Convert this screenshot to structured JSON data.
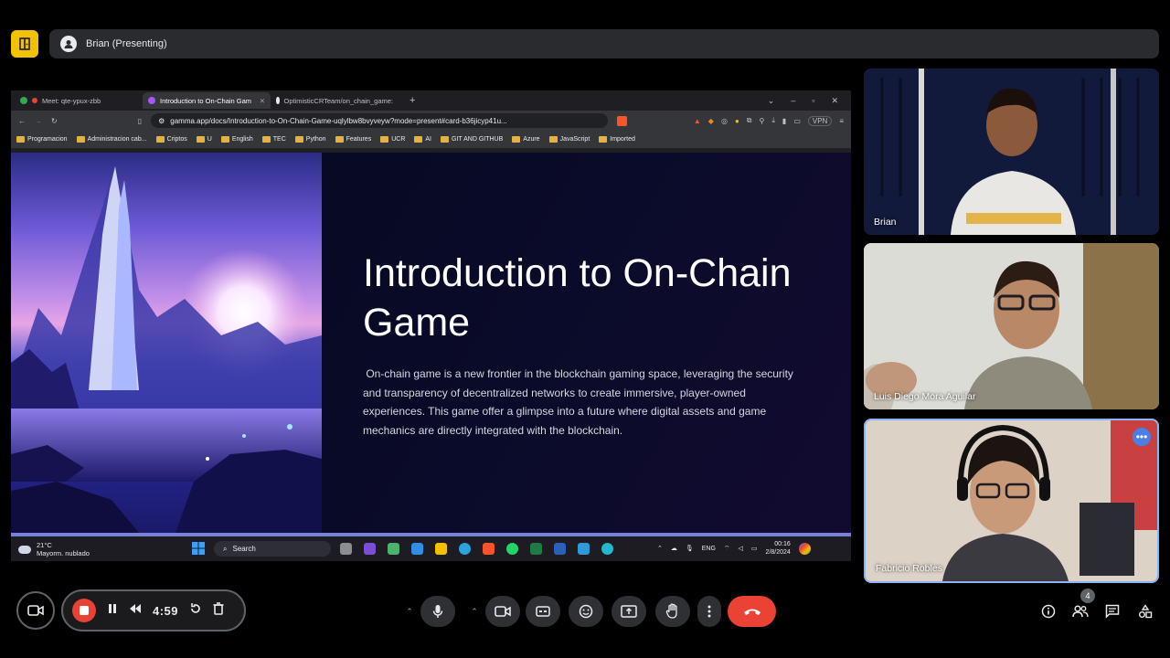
{
  "topbar": {
    "presenter_label": "Brian (Presenting)"
  },
  "browser": {
    "tabs": [
      {
        "label": "Meet: qte-ypux-zbb"
      },
      {
        "label": "Introduction to On-Chain Gam"
      },
      {
        "label": "OptimisticCRTeam/on_chain_game:"
      }
    ],
    "url": "gamma.app/docs/Introduction-to-On-Chain-Game-uqlylbw8bvyveyw?mode=present#card-b36jicyp41u...",
    "vpn_label": "VPN",
    "bookmarks": [
      "Programacion",
      "Administracion cab...",
      "Criptos",
      "U",
      "English",
      "TEC",
      "Python",
      "Features",
      "UCR",
      "AI",
      "GIT AND GITHUB",
      "Azure",
      "JavaScript",
      "Imported"
    ]
  },
  "slide": {
    "title": "Introduction to On-Chain Game",
    "body": " On-chain game is a new frontier in the blockchain gaming space, leveraging the security and transparency of decentralized networks to create immersive, player-owned experiences. This game offer a glimpse into a future where digital assets and game mechanics are directly integrated with the blockchain."
  },
  "taskbar": {
    "temperature": "21°C",
    "weather": "Mayorm. nublado",
    "search_label": "Search",
    "language": "ENG",
    "time": "00:16",
    "date": "2/8/2024"
  },
  "participants": [
    {
      "name": "Brian"
    },
    {
      "name": "Luis Diego Mora Aguilar"
    },
    {
      "name": "Fabricio Robles"
    }
  ],
  "recording": {
    "elapsed": "4:59"
  },
  "people_count": "4",
  "colors": {
    "presenter_accent": "#f2c200",
    "end_call": "#ea4335",
    "record": "#e94235",
    "active_speaker_border": "#8ab4f8"
  }
}
